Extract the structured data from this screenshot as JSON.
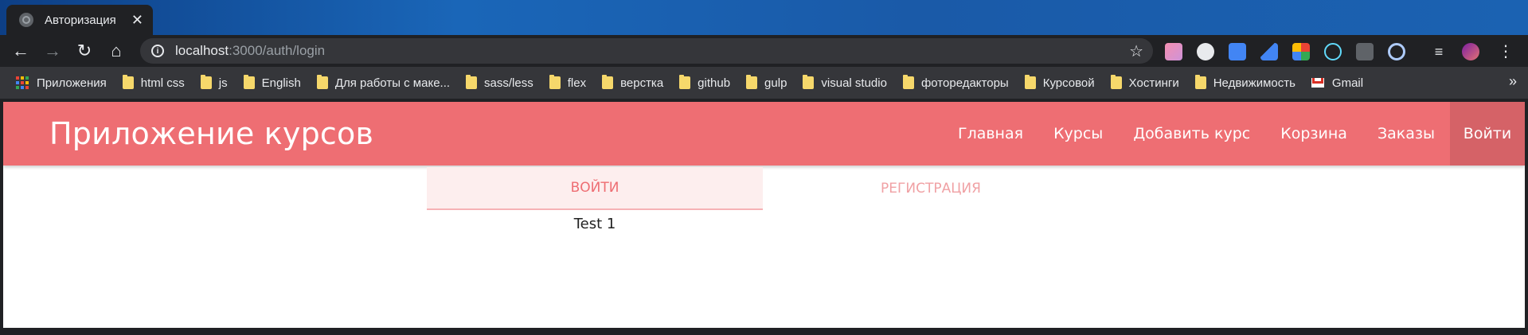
{
  "browser": {
    "tab": {
      "title": "Авторизация",
      "close": "✕"
    },
    "nav": {
      "back": "←",
      "forward": "→",
      "reload": "↻",
      "home": "⌂"
    },
    "url": {
      "host": "localhost",
      "path": ":3000/auth/login"
    },
    "star": "☆",
    "bookmarks": [
      {
        "label": "Приложения",
        "icon": "apps-icon"
      },
      {
        "label": "html css",
        "icon": "folder-icon"
      },
      {
        "label": "js",
        "icon": "folder-icon"
      },
      {
        "label": "English",
        "icon": "folder-icon"
      },
      {
        "label": "Для работы с маке...",
        "icon": "folder-icon"
      },
      {
        "label": "sass/less",
        "icon": "folder-icon"
      },
      {
        "label": "flex",
        "icon": "folder-icon"
      },
      {
        "label": "верстка",
        "icon": "folder-icon"
      },
      {
        "label": "github",
        "icon": "folder-icon"
      },
      {
        "label": "gulp",
        "icon": "folder-icon"
      },
      {
        "label": "visual studio",
        "icon": "folder-icon"
      },
      {
        "label": "фоторедакторы",
        "icon": "folder-icon"
      },
      {
        "label": "Курсовой",
        "icon": "folder-icon"
      },
      {
        "label": "Хостинги",
        "icon": "folder-icon"
      },
      {
        "label": "Недвижимость",
        "icon": "folder-icon"
      },
      {
        "label": "Gmail",
        "icon": "gmail-icon"
      }
    ],
    "more": "»"
  },
  "app": {
    "brand": "Приложение курсов",
    "nav": [
      "Главная",
      "Курсы",
      "Добавить курс",
      "Корзина",
      "Заказы",
      "Войти"
    ],
    "tabs": {
      "login": "Войти",
      "register": "Регистрация"
    },
    "content": "Test 1"
  },
  "colors": {
    "accent": "#ee6e73",
    "tab_active_bg": "#fdeeee"
  }
}
